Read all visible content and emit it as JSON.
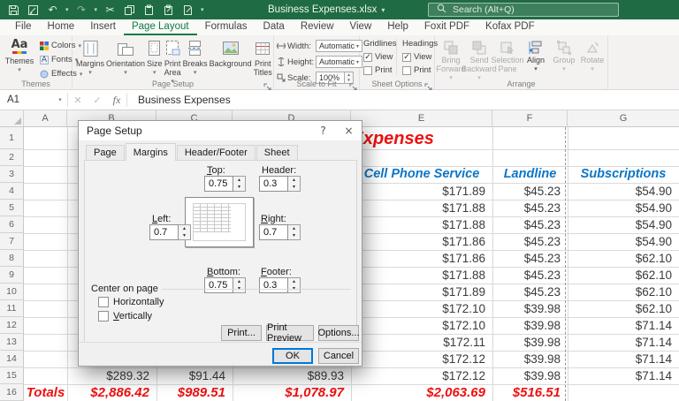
{
  "titlebar": {
    "title": "Business Expenses.xlsx",
    "search_placeholder": "Search (Alt+Q)"
  },
  "icons": {
    "dropdown": "▾",
    "undo": "↶",
    "redo": "↷",
    "cut": "✂",
    "check": "✓",
    "close": "×",
    "help": "?",
    "fx": "fx",
    "cancel_x": "✕",
    "confirm_check": "✓",
    "spinner_up": "▴",
    "spinner_down": "▾",
    "themes_aa": "Aa",
    "fonts_a": "A"
  },
  "ribbon_tabs": {
    "items": [
      "File",
      "Home",
      "Insert",
      "Page Layout",
      "Formulas",
      "Data",
      "Review",
      "View",
      "Help",
      "Foxit PDF",
      "Kofax PDF"
    ],
    "active": "Page Layout"
  },
  "ribbon": {
    "themes": {
      "group_label": "Themes",
      "themes": "Themes",
      "colors": "Colors",
      "fonts": "Fonts",
      "effects": "Effects"
    },
    "page_setup": {
      "group_label": "Page Setup",
      "margins": "Margins",
      "orientation": "Orientation",
      "size": "Size",
      "print_area": "Print Area",
      "breaks": "Breaks",
      "background": "Background",
      "print_titles": "Print Titles"
    },
    "scale_to_fit": {
      "group_label": "Scale to Fit",
      "width_label": "Width:",
      "width_value": "Automatic",
      "height_label": "Height:",
      "height_value": "Automatic",
      "scale_label": "Scale:",
      "scale_value": "100%"
    },
    "sheet_options": {
      "group_label": "Sheet Options",
      "gridlines": "Gridlines",
      "headings": "Headings",
      "view": "View",
      "print": "Print",
      "gridlines_view_checked": true,
      "gridlines_print_checked": false,
      "headings_view_checked": true,
      "headings_print_checked": false
    },
    "arrange": {
      "group_label": "Arrange",
      "bring_forward": "Bring Forward",
      "send_backward": "Send Backward",
      "selection_pane": "Selection Pane",
      "align": "Align",
      "group": "Group",
      "rotate": "Rotate"
    }
  },
  "formula_bar": {
    "name_box": "A1",
    "formula": "Business Expenses"
  },
  "sheet": {
    "columns": [
      "A",
      "B",
      "C",
      "D",
      "E",
      "F",
      "G"
    ],
    "rows": [
      "1",
      "2",
      "3",
      "4",
      "5",
      "6",
      "7",
      "8",
      "9",
      "10",
      "11",
      "12",
      "13",
      "14",
      "15",
      "16"
    ],
    "title": "Business Expenses",
    "headers": {
      "cell_phone": "Cell Phone Service",
      "landline": "Landline",
      "subscriptions": "Subscriptions"
    },
    "cell_phone": [
      "$171.89",
      "$171.88",
      "$171.88",
      "$171.86",
      "$171.86",
      "$171.88",
      "$171.89",
      "$172.10",
      "$172.10",
      "$172.11",
      "$172.12",
      "$172.12"
    ],
    "landline": [
      "$45.23",
      "$45.23",
      "$45.23",
      "$45.23",
      "$45.23",
      "$45.23",
      "$45.23",
      "$39.98",
      "$39.98",
      "$39.98",
      "$39.98",
      "$39.98"
    ],
    "subscriptions": [
      "$54.90",
      "$54.90",
      "$54.90",
      "$54.90",
      "$62.10",
      "$62.10",
      "$62.10",
      "$62.10",
      "$71.14",
      "$71.14",
      "$71.14",
      "$71.14"
    ],
    "row15": {
      "b": "$289.32",
      "c": "$91.44",
      "d": "$89.93"
    },
    "totals": {
      "label": "Totals",
      "b": "$2,886.42",
      "c": "$989.51",
      "d": "$1,078.97",
      "e": "$2,063.69",
      "f": "$516.51"
    }
  },
  "dialog": {
    "title": "Page Setup",
    "tabs": [
      "Page",
      "Margins",
      "Header/Footer",
      "Sheet"
    ],
    "active_tab": "Margins",
    "margins": {
      "top_label": "Top:",
      "top_value": "0.75",
      "header_label": "Header:",
      "header_value": "0.3",
      "left_label": "Left:",
      "left_value": "0.7",
      "right_label": "Right:",
      "right_value": "0.7",
      "bottom_label": "Bottom:",
      "bottom_value": "0.75",
      "footer_label": "Footer:",
      "footer_value": "0.3"
    },
    "center_on_page": {
      "label": "Center on page",
      "horizontally": "Horizontally",
      "vertically": "Vertically",
      "horizontally_checked": false,
      "vertically_checked": false
    },
    "buttons": {
      "print": "Print...",
      "print_preview": "Print Preview",
      "options": "Options...",
      "ok": "OK",
      "cancel": "Cancel"
    }
  },
  "colors": {
    "titlebar_green": "#1f6b43",
    "active_tab_green": "#0f7b42",
    "header_blue": "#0b76c9",
    "accent_red": "#ee1111",
    "focus_blue": "#0078d7"
  }
}
